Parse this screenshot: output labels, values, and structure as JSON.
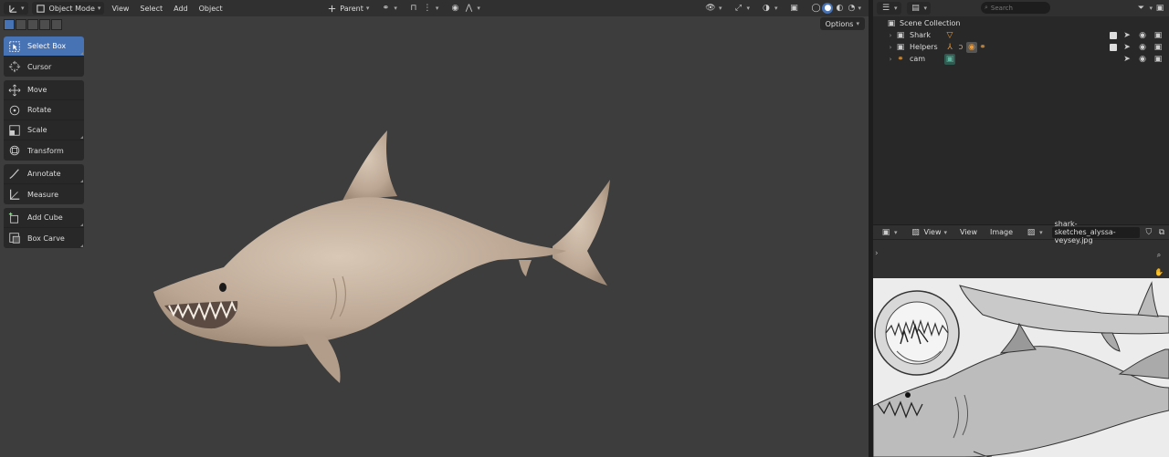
{
  "viewport": {
    "header": {
      "mode_label": "Object Mode",
      "menus": [
        "View",
        "Select",
        "Add",
        "Object"
      ],
      "pivot_label": "Parent"
    },
    "options_label": "Options",
    "tools": [
      {
        "label": "Select Box",
        "icon": "select-box-icon",
        "active": true
      },
      {
        "label": "Cursor",
        "icon": "cursor-icon"
      },
      {
        "label": "Move",
        "icon": "move-icon"
      },
      {
        "label": "Rotate",
        "icon": "rotate-icon"
      },
      {
        "label": "Scale",
        "icon": "scale-icon"
      },
      {
        "label": "Transform",
        "icon": "transform-icon"
      },
      {
        "label": "Annotate",
        "icon": "annotate-icon"
      },
      {
        "label": "Measure",
        "icon": "measure-icon"
      },
      {
        "label": "Add Cube",
        "icon": "add-cube-icon"
      },
      {
        "label": "Box Carve",
        "icon": "box-carve-icon"
      }
    ]
  },
  "outliner": {
    "search_placeholder": "Search",
    "root_label": "Scene Collection",
    "items": [
      {
        "label": "Shark",
        "visible_checkbox": true
      },
      {
        "label": "Helpers",
        "visible_checkbox": true
      },
      {
        "label": "cam",
        "visible_checkbox": false
      }
    ]
  },
  "image_editor": {
    "menus": [
      "View",
      "View",
      "Image"
    ],
    "filename": "shark-sketches_alyssa-veysey.jpg"
  },
  "colors": {
    "accent": "#4772b3",
    "viewport_bg": "#3d3d3d",
    "shark": "#c9b7a5",
    "collection_orange": "#e89a3c"
  }
}
